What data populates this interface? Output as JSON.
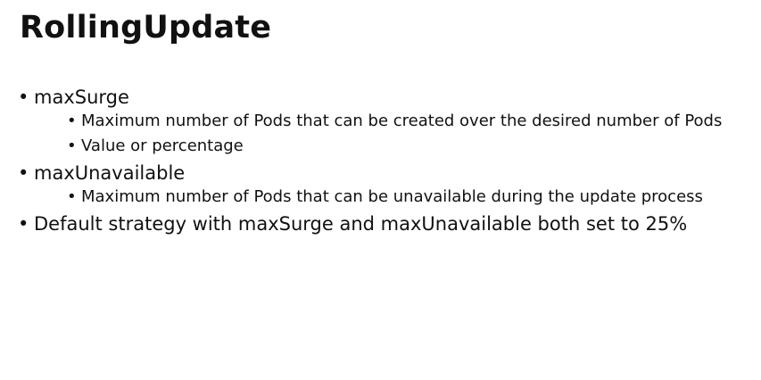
{
  "slide": {
    "title": "RollingUpdate",
    "bullet_glyph": "•",
    "items": [
      {
        "text": "maxSurge",
        "sub": [
          "Maximum number of Pods that can be created over the desired number of Pods",
          "Value or percentage"
        ]
      },
      {
        "text": "maxUnavailable",
        "sub": [
          "Maximum number of Pods that can be unavailable during the update process"
        ]
      },
      {
        "text": "Default strategy with maxSurge and maxUnavailable both set to 25%",
        "sub": []
      }
    ]
  }
}
